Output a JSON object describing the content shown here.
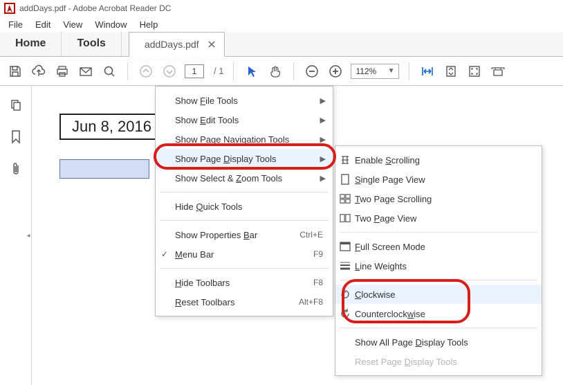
{
  "title": "addDays.pdf - Adobe Acrobat Reader DC",
  "menubar": [
    "File",
    "Edit",
    "View",
    "Window",
    "Help"
  ],
  "tabs": {
    "home": "Home",
    "tools": "Tools",
    "doc": "addDays.pdf"
  },
  "toolbar": {
    "page_current": "1",
    "page_total": "/ 1",
    "zoom": "112%"
  },
  "document": {
    "date_text": "Jun 8, 2016"
  },
  "context_menu": {
    "items": [
      {
        "label": "Show File Tools",
        "mn": "F",
        "arrow": true
      },
      {
        "label": "Show Edit Tools",
        "mn": "E",
        "arrow": true
      },
      {
        "label": "Show Page Navigation Tools",
        "mn": "N",
        "arrow": true
      },
      {
        "label": "Show Page Display Tools",
        "mn": "D",
        "arrow": true,
        "highlight": true
      },
      {
        "label": "Show Select & Zoom Tools",
        "mn": "Z",
        "arrow": true
      },
      {
        "sep": true
      },
      {
        "label": "Hide Quick Tools",
        "mn": "Q"
      },
      {
        "sep": true
      },
      {
        "label": "Show Properties Bar",
        "mn": "B",
        "shortcut": "Ctrl+E"
      },
      {
        "label": "Menu Bar",
        "mn": "M",
        "shortcut": "F9",
        "checked": true
      },
      {
        "sep": true
      },
      {
        "label": "Hide Toolbars",
        "mn": "H",
        "shortcut": "F8"
      },
      {
        "label": "Reset Toolbars",
        "mn": "R",
        "shortcut": "Alt+F8"
      }
    ]
  },
  "submenu": {
    "items": [
      {
        "label": "Enable Scrolling",
        "mn": "S",
        "icon": "scroll"
      },
      {
        "label": "Single Page View",
        "mn": "S",
        "icon": "single-page"
      },
      {
        "label": "Two Page Scrolling",
        "mn": "T",
        "icon": "two-scroll"
      },
      {
        "label": "Two Page View",
        "mn": "P",
        "icon": "two-page"
      },
      {
        "sep": true
      },
      {
        "label": "Full Screen Mode",
        "mn": "F",
        "icon": "fullscreen"
      },
      {
        "label": "Line Weights",
        "mn": "L",
        "icon": "line-weights"
      },
      {
        "sep": true
      },
      {
        "label": "Clockwise",
        "mn": "C",
        "icon": "rotate-cw",
        "highlight": true
      },
      {
        "label": "Counterclockwise",
        "mn": "w",
        "icon": "rotate-ccw"
      },
      {
        "sep": true
      },
      {
        "label": "Show All Page Display Tools",
        "mn": "D"
      },
      {
        "label": "Reset Page Display Tools",
        "mn": "D",
        "disabled": true
      }
    ]
  }
}
